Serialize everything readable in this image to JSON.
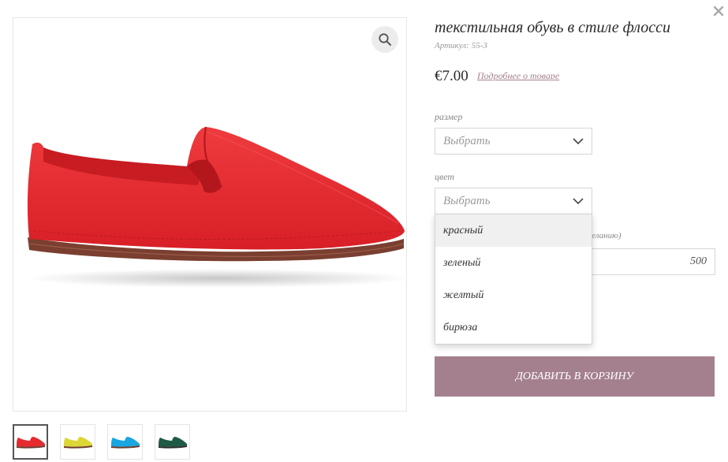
{
  "product": {
    "title": "текстильная обувь в стиле флосси",
    "sku_label": "Артикул:",
    "sku_value": "55-3",
    "price": "€7.00",
    "details_link": "Подробнее о товаре"
  },
  "size_field": {
    "label": "размер",
    "placeholder": "Выбрать"
  },
  "color_field": {
    "label": "цвет",
    "placeholder": "Выбрать",
    "options": [
      "красный",
      "зеленый",
      "желтый",
      "бирюза"
    ],
    "highlighted_option": "красный"
  },
  "amount_field": {
    "label_partial": "желанию)",
    "value": "500"
  },
  "add_to_cart": {
    "label": "ДОБАВИТЬ В КОРЗИНУ"
  },
  "thumbnails": [
    {
      "color_name": "red",
      "shoe_color": "#e62a2e",
      "sole_color": "#6b3a2c"
    },
    {
      "color_name": "yellow",
      "shoe_color": "#dcd737",
      "sole_color": "#6b3a2c"
    },
    {
      "color_name": "blue",
      "shoe_color": "#1aa6e0",
      "sole_color": "#6b3a2c"
    },
    {
      "color_name": "green",
      "shoe_color": "#1f5a45",
      "sole_color": "#2b2b2b"
    }
  ],
  "icons": {
    "zoom": "magnifier-icon",
    "close": "close-icon",
    "chevron": "chevron-down-icon"
  },
  "colors": {
    "accent": "#a4808f",
    "shoe_red": "#e62a2e",
    "sole": "#7a3f30"
  }
}
